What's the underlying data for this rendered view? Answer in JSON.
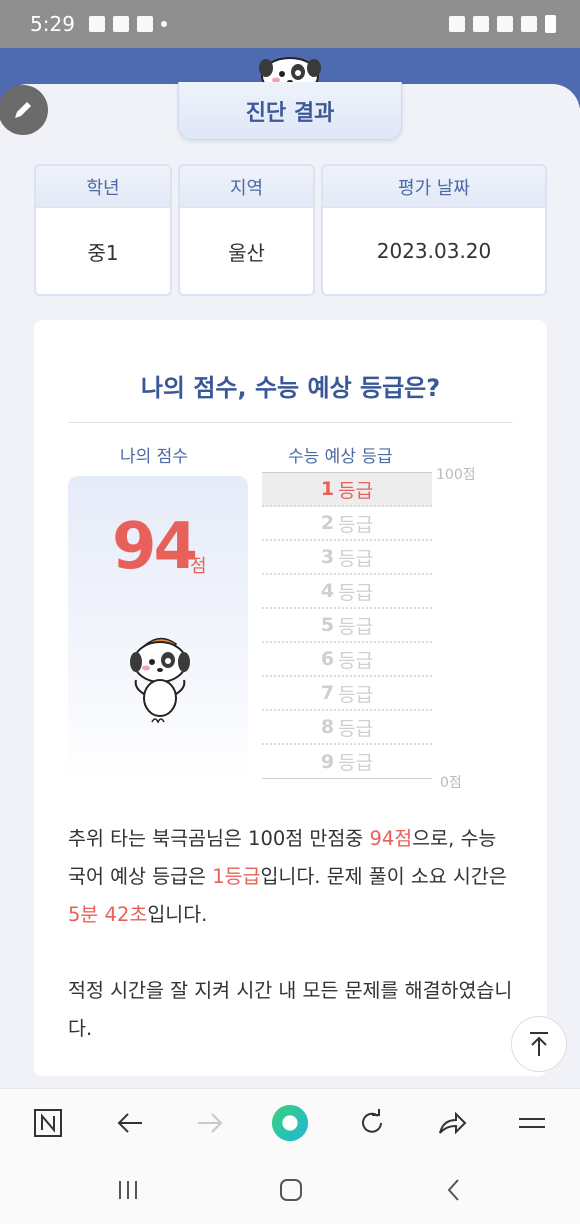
{
  "status_bar": {
    "time": "5:29"
  },
  "page": {
    "title": "진단 결과"
  },
  "info": [
    {
      "label": "학년",
      "value": "중1"
    },
    {
      "label": "지역",
      "value": "울산"
    },
    {
      "label": "평가 날짜",
      "value": "2023.03.20"
    }
  ],
  "result": {
    "heading": "나의 점수, 수능 예상 등급은?",
    "score_label": "나의 점수",
    "grade_label": "수능 예상 등급",
    "score": "94",
    "score_unit": "점",
    "scale_top": "100점",
    "scale_bottom": "0점",
    "grade_unit": "등급",
    "grades": [
      "1",
      "2",
      "3",
      "4",
      "5",
      "6",
      "7",
      "8",
      "9"
    ],
    "active_grade": "1"
  },
  "description": {
    "p1_a": "추위 타는 북극곰님은 100점 만점중 ",
    "p1_score": "94점",
    "p1_b": "으로, 수능 국어 예상 등급은 ",
    "p1_grade": "1등급",
    "p1_c": "입니다. 문제 풀이 소요 시간은 ",
    "p1_time": "5분 42초",
    "p1_d": "입니다.",
    "p2": "적정 시간을 잘 지켜 시간 내 모든 문제를 해결하였습니다."
  },
  "browser_icons": [
    "naver-home-icon",
    "back-arrow-icon",
    "forward-arrow-icon",
    "green-dot-icon",
    "refresh-icon",
    "share-icon",
    "menu-icon"
  ],
  "colors": {
    "brand_blue": "#4e6bb0",
    "accent_red": "#e8605a",
    "header_text": "#3a5898"
  }
}
